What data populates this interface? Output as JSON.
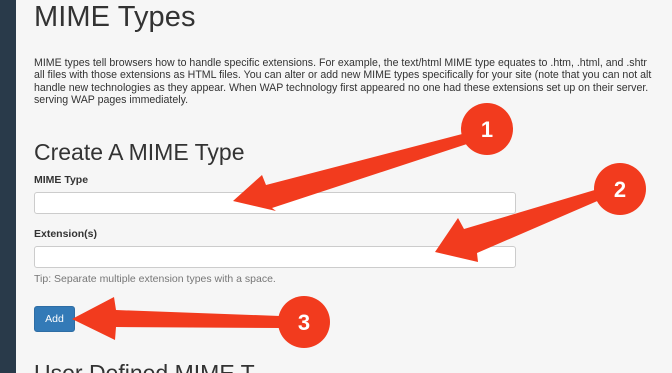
{
  "page": {
    "title": "MIME Types",
    "description_lines": [
      "MIME types tell browsers how to handle specific extensions. For example, the text/html MIME type equates to .htm, .html, and .shtr",
      "all files with those extensions as HTML files. You can alter or add new MIME types specifically for your site (note that you can not alt",
      "handle new technologies as they appear. When WAP technology first appeared no one had these extensions set up on their server.",
      "serving WAP pages immediately."
    ]
  },
  "create_section": {
    "title": "Create A MIME Type",
    "mime_type_label": "MIME Type",
    "mime_type_value": "",
    "extensions_label": "Extension(s)",
    "extensions_value": "",
    "tip": "Tip: Separate multiple extension types with a space.",
    "add_button_label": "Add"
  },
  "next_section": {
    "title": "User Defined MIME T"
  },
  "annotations": {
    "color": "#f23b1e",
    "callouts": [
      {
        "number": "1",
        "points_to": "mime-type-input"
      },
      {
        "number": "2",
        "points_to": "extensions-input"
      },
      {
        "number": "3",
        "points_to": "add-button"
      }
    ]
  },
  "colors": {
    "sidebar": "#293a4a",
    "background": "#f6f6f6",
    "primary_button": "#337ab7"
  }
}
